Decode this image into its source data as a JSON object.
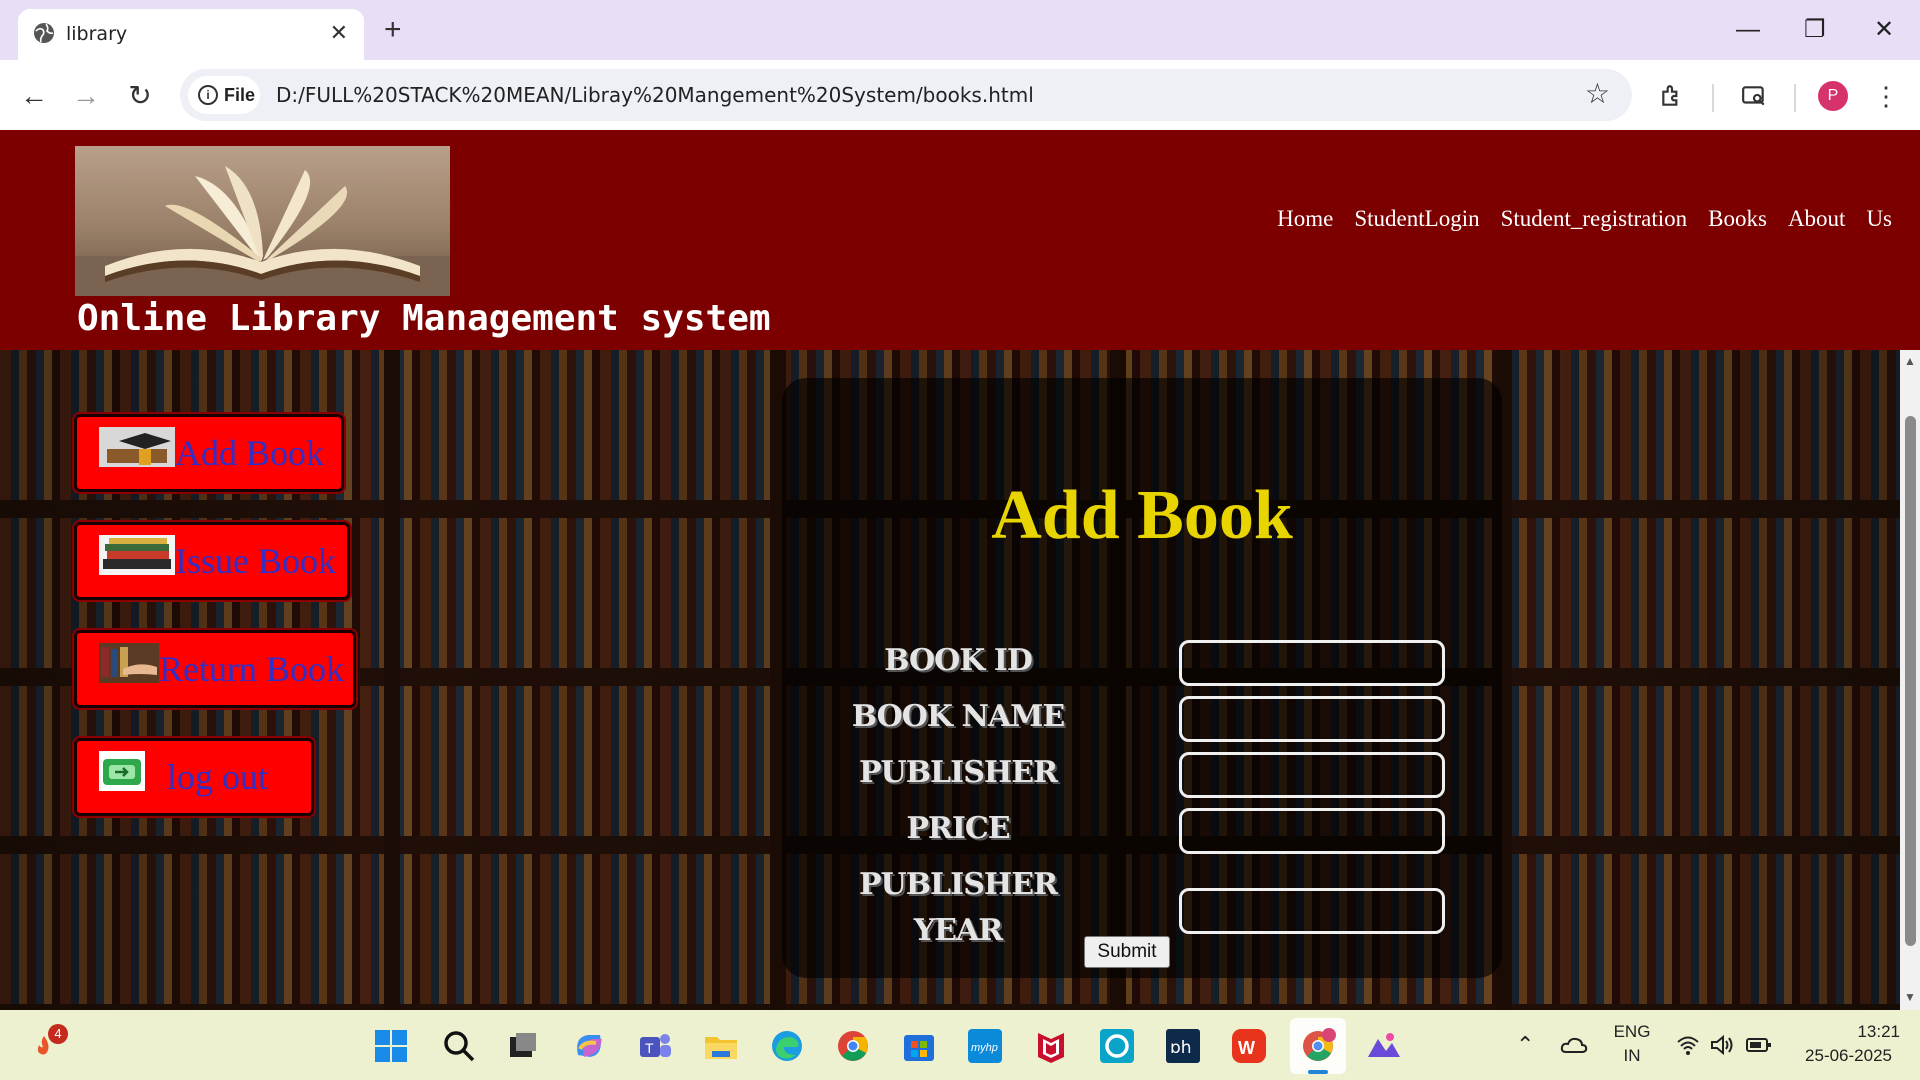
{
  "browser": {
    "tab_title": "library",
    "tab_close": "✕",
    "new_tab": "+",
    "window_controls": {
      "minimize": "—",
      "restore": "❐",
      "close": "✕"
    },
    "nav": {
      "back": "←",
      "forward": "→",
      "reload": "↻"
    },
    "site_chip": {
      "info": "i",
      "label": "File"
    },
    "url": "D:/FULL%20STACK%20MEAN/Libray%20Mangement%20System/books.html",
    "bookmark_star": "☆",
    "profile_initial": "P"
  },
  "site": {
    "title": "Online Library Management system",
    "nav_links": [
      "Home",
      "StudentLogin",
      "Student_registration",
      "Books",
      "About",
      "Us"
    ]
  },
  "sidebar": {
    "buttons": [
      {
        "label": "Add Book"
      },
      {
        "label": "Issue Book"
      },
      {
        "label": "Return Book"
      },
      {
        "label": "log out"
      }
    ]
  },
  "form": {
    "title": "Add Book",
    "fields": [
      {
        "label": "BOOK ID",
        "value": ""
      },
      {
        "label": "BOOK NAME",
        "value": ""
      },
      {
        "label": "PUBLISHER",
        "value": ""
      },
      {
        "label": "PRICE",
        "value": ""
      },
      {
        "label": "PUBLISHER YEAR",
        "value": ""
      }
    ],
    "submit_label": "Submit"
  },
  "taskbar": {
    "notification_count": "4",
    "language": "ENG",
    "region": "IN",
    "time": "13:21",
    "date": "25-06-2025"
  },
  "colors": {
    "header_bg": "#7c0000",
    "sidebar_button_bg": "#ff0000",
    "sidebar_button_text": "#3030c8",
    "form_title": "#e8d400"
  }
}
